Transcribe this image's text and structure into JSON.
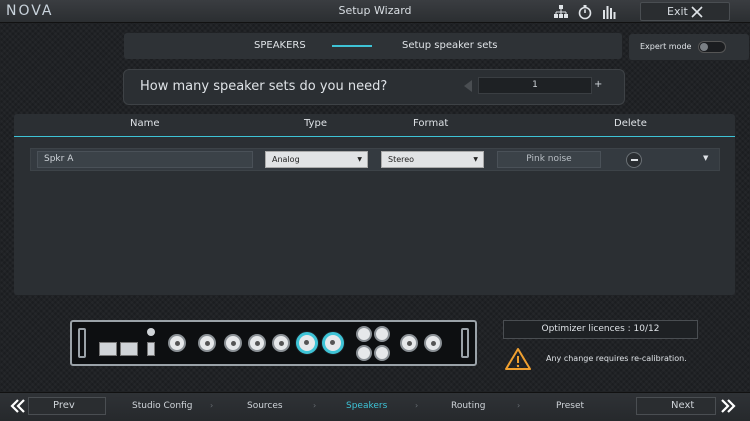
{
  "app": {
    "logo": "NOVA",
    "window_title": "Setup Wizard",
    "exit_label": "Exit"
  },
  "header": {
    "step_a": "SPEAKERS",
    "step_b": "Setup speaker sets",
    "expert_mode_label": "Expert mode",
    "expert_mode_on": false
  },
  "question": {
    "text": "How many speaker sets do you need?",
    "count": "1",
    "increment": "+"
  },
  "table": {
    "columns": [
      "Name",
      "Type",
      "Format",
      "Delete"
    ],
    "rows": [
      {
        "name": "Spkr A",
        "type": "Analog",
        "format": "Stereo",
        "action": "Pink noise"
      }
    ]
  },
  "licence": {
    "text": "Optimizer licences : 10/12"
  },
  "warning": {
    "text": "Any change requires re-calibration."
  },
  "nav": {
    "prev": "Prev",
    "next": "Next",
    "steps": [
      "Studio Config",
      "Sources",
      "Speakers",
      "Routing",
      "Preset"
    ],
    "active": "Speakers"
  },
  "colors": {
    "accent": "#3ec3d6",
    "warning": "#f0a030"
  }
}
